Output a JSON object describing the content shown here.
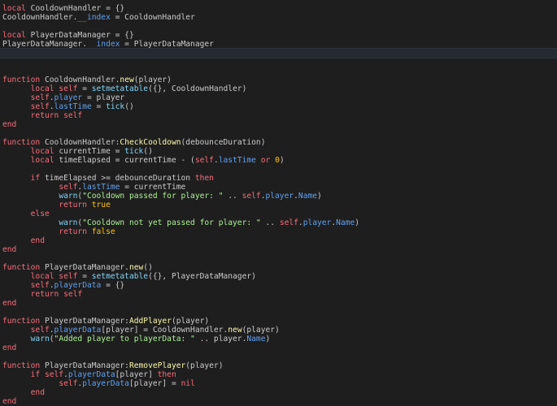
{
  "colors": {
    "background": "#1e1e1e",
    "current_line": "#252a33",
    "keyword": "#f86d7c",
    "builtin": "#84d6f7",
    "property": "#61a1f1",
    "string": "#adf195",
    "number": "#ffc600",
    "function_name": "#fdfbac",
    "plain": "#cccccc"
  },
  "editor": {
    "current_line_index": 5,
    "lines": [
      [
        [
          "kw",
          "local"
        ],
        [
          "pl",
          " CooldownHandler = {}"
        ]
      ],
      [
        [
          "pl",
          "CooldownHandler."
        ],
        [
          "prop",
          "__index"
        ],
        [
          "pl",
          " = CooldownHandler"
        ]
      ],
      [],
      [
        [
          "kw",
          "local"
        ],
        [
          "pl",
          " PlayerDataManager = {}"
        ]
      ],
      [
        [
          "pl",
          "PlayerDataManager."
        ],
        [
          "prop",
          "__index"
        ],
        [
          "pl",
          " = PlayerDataManager"
        ]
      ],
      [],
      [],
      [],
      [
        [
          "kw",
          "function"
        ],
        [
          "pl",
          " CooldownHandler."
        ],
        [
          "fn",
          "new"
        ],
        [
          "pl",
          "(player)"
        ]
      ],
      [
        [
          "pl",
          "      "
        ],
        [
          "kw",
          "local self"
        ],
        [
          "pl",
          " = "
        ],
        [
          "bi",
          "setmetatable"
        ],
        [
          "pl",
          "({}, CooldownHandler)"
        ]
      ],
      [
        [
          "pl",
          "      "
        ],
        [
          "kw",
          "self"
        ],
        [
          "pl",
          "."
        ],
        [
          "prop",
          "player"
        ],
        [
          "pl",
          " = player"
        ]
      ],
      [
        [
          "pl",
          "      "
        ],
        [
          "kw",
          "self"
        ],
        [
          "pl",
          "."
        ],
        [
          "prop",
          "lastTime"
        ],
        [
          "pl",
          " = "
        ],
        [
          "bi",
          "tick"
        ],
        [
          "pl",
          "()"
        ]
      ],
      [
        [
          "pl",
          "      "
        ],
        [
          "kw",
          "return self"
        ]
      ],
      [
        [
          "kw",
          "end"
        ]
      ],
      [],
      [
        [
          "kw",
          "function"
        ],
        [
          "pl",
          " CooldownHandler:"
        ],
        [
          "fn",
          "CheckCooldown"
        ],
        [
          "pl",
          "(debounceDuration)"
        ]
      ],
      [
        [
          "pl",
          "      "
        ],
        [
          "kw",
          "local"
        ],
        [
          "pl",
          " currentTime = "
        ],
        [
          "bi",
          "tick"
        ],
        [
          "pl",
          "()"
        ]
      ],
      [
        [
          "pl",
          "      "
        ],
        [
          "kw",
          "local"
        ],
        [
          "pl",
          " timeElapsed = currentTime - ("
        ],
        [
          "kw",
          "self"
        ],
        [
          "pl",
          "."
        ],
        [
          "prop",
          "lastTime"
        ],
        [
          "pl",
          " "
        ],
        [
          "kw",
          "or"
        ],
        [
          "pl",
          " "
        ],
        [
          "num",
          "0"
        ],
        [
          "pl",
          ")"
        ]
      ],
      [],
      [
        [
          "pl",
          "      "
        ],
        [
          "kw",
          "if"
        ],
        [
          "pl",
          " timeElapsed >= debounceDuration "
        ],
        [
          "kw",
          "then"
        ]
      ],
      [
        [
          "pl",
          "            "
        ],
        [
          "kw",
          "self"
        ],
        [
          "pl",
          "."
        ],
        [
          "prop",
          "lastTime"
        ],
        [
          "pl",
          " = currentTime"
        ]
      ],
      [
        [
          "pl",
          "            "
        ],
        [
          "bi",
          "warn"
        ],
        [
          "pl",
          "("
        ],
        [
          "str",
          "\"Cooldown passed for player: \""
        ],
        [
          "pl",
          " .. "
        ],
        [
          "kw",
          "self"
        ],
        [
          "pl",
          "."
        ],
        [
          "prop",
          "player"
        ],
        [
          "pl",
          "."
        ],
        [
          "prop",
          "Name"
        ],
        [
          "pl",
          ")"
        ]
      ],
      [
        [
          "pl",
          "            "
        ],
        [
          "kw",
          "return"
        ],
        [
          "pl",
          " "
        ],
        [
          "bool",
          "true"
        ]
      ],
      [
        [
          "pl",
          "      "
        ],
        [
          "kw",
          "else"
        ]
      ],
      [
        [
          "pl",
          "            "
        ],
        [
          "bi",
          "warn"
        ],
        [
          "pl",
          "("
        ],
        [
          "str",
          "\"Cooldown not yet passed for player: \""
        ],
        [
          "pl",
          " .. "
        ],
        [
          "kw",
          "self"
        ],
        [
          "pl",
          "."
        ],
        [
          "prop",
          "player"
        ],
        [
          "pl",
          "."
        ],
        [
          "prop",
          "Name"
        ],
        [
          "pl",
          ")"
        ]
      ],
      [
        [
          "pl",
          "            "
        ],
        [
          "kw",
          "return"
        ],
        [
          "pl",
          " "
        ],
        [
          "bool",
          "false"
        ]
      ],
      [
        [
          "pl",
          "      "
        ],
        [
          "kw",
          "end"
        ]
      ],
      [
        [
          "kw",
          "end"
        ]
      ],
      [],
      [
        [
          "kw",
          "function"
        ],
        [
          "pl",
          " PlayerDataManager."
        ],
        [
          "fn",
          "new"
        ],
        [
          "pl",
          "()"
        ]
      ],
      [
        [
          "pl",
          "      "
        ],
        [
          "kw",
          "local self"
        ],
        [
          "pl",
          " = "
        ],
        [
          "bi",
          "setmetatable"
        ],
        [
          "pl",
          "({}, PlayerDataManager)"
        ]
      ],
      [
        [
          "pl",
          "      "
        ],
        [
          "kw",
          "self"
        ],
        [
          "pl",
          "."
        ],
        [
          "prop",
          "playerData"
        ],
        [
          "pl",
          " = {}"
        ]
      ],
      [
        [
          "pl",
          "      "
        ],
        [
          "kw",
          "return self"
        ]
      ],
      [
        [
          "kw",
          "end"
        ]
      ],
      [],
      [
        [
          "kw",
          "function"
        ],
        [
          "pl",
          " PlayerDataManager:"
        ],
        [
          "fn",
          "AddPlayer"
        ],
        [
          "pl",
          "(player)"
        ]
      ],
      [
        [
          "pl",
          "      "
        ],
        [
          "kw",
          "self"
        ],
        [
          "pl",
          "."
        ],
        [
          "prop",
          "playerData"
        ],
        [
          "pl",
          "[player] = CooldownHandler."
        ],
        [
          "fn",
          "new"
        ],
        [
          "pl",
          "(player)"
        ]
      ],
      [
        [
          "pl",
          "      "
        ],
        [
          "bi",
          "warn"
        ],
        [
          "pl",
          "("
        ],
        [
          "str",
          "\"Added player to playerData: \""
        ],
        [
          "pl",
          " .. player."
        ],
        [
          "prop",
          "Name"
        ],
        [
          "pl",
          ")"
        ]
      ],
      [
        [
          "kw",
          "end"
        ]
      ],
      [],
      [
        [
          "kw",
          "function"
        ],
        [
          "pl",
          " PlayerDataManager:"
        ],
        [
          "fn",
          "RemovePlayer"
        ],
        [
          "pl",
          "(player)"
        ]
      ],
      [
        [
          "pl",
          "      "
        ],
        [
          "kw",
          "if self"
        ],
        [
          "pl",
          "."
        ],
        [
          "prop",
          "playerData"
        ],
        [
          "pl",
          "[player] "
        ],
        [
          "kw",
          "then"
        ]
      ],
      [
        [
          "pl",
          "            "
        ],
        [
          "kw",
          "self"
        ],
        [
          "pl",
          "."
        ],
        [
          "prop",
          "playerData"
        ],
        [
          "pl",
          "[player] = "
        ],
        [
          "kw",
          "nil"
        ]
      ],
      [
        [
          "pl",
          "      "
        ],
        [
          "kw",
          "end"
        ]
      ],
      [
        [
          "kw",
          "end"
        ]
      ]
    ]
  }
}
